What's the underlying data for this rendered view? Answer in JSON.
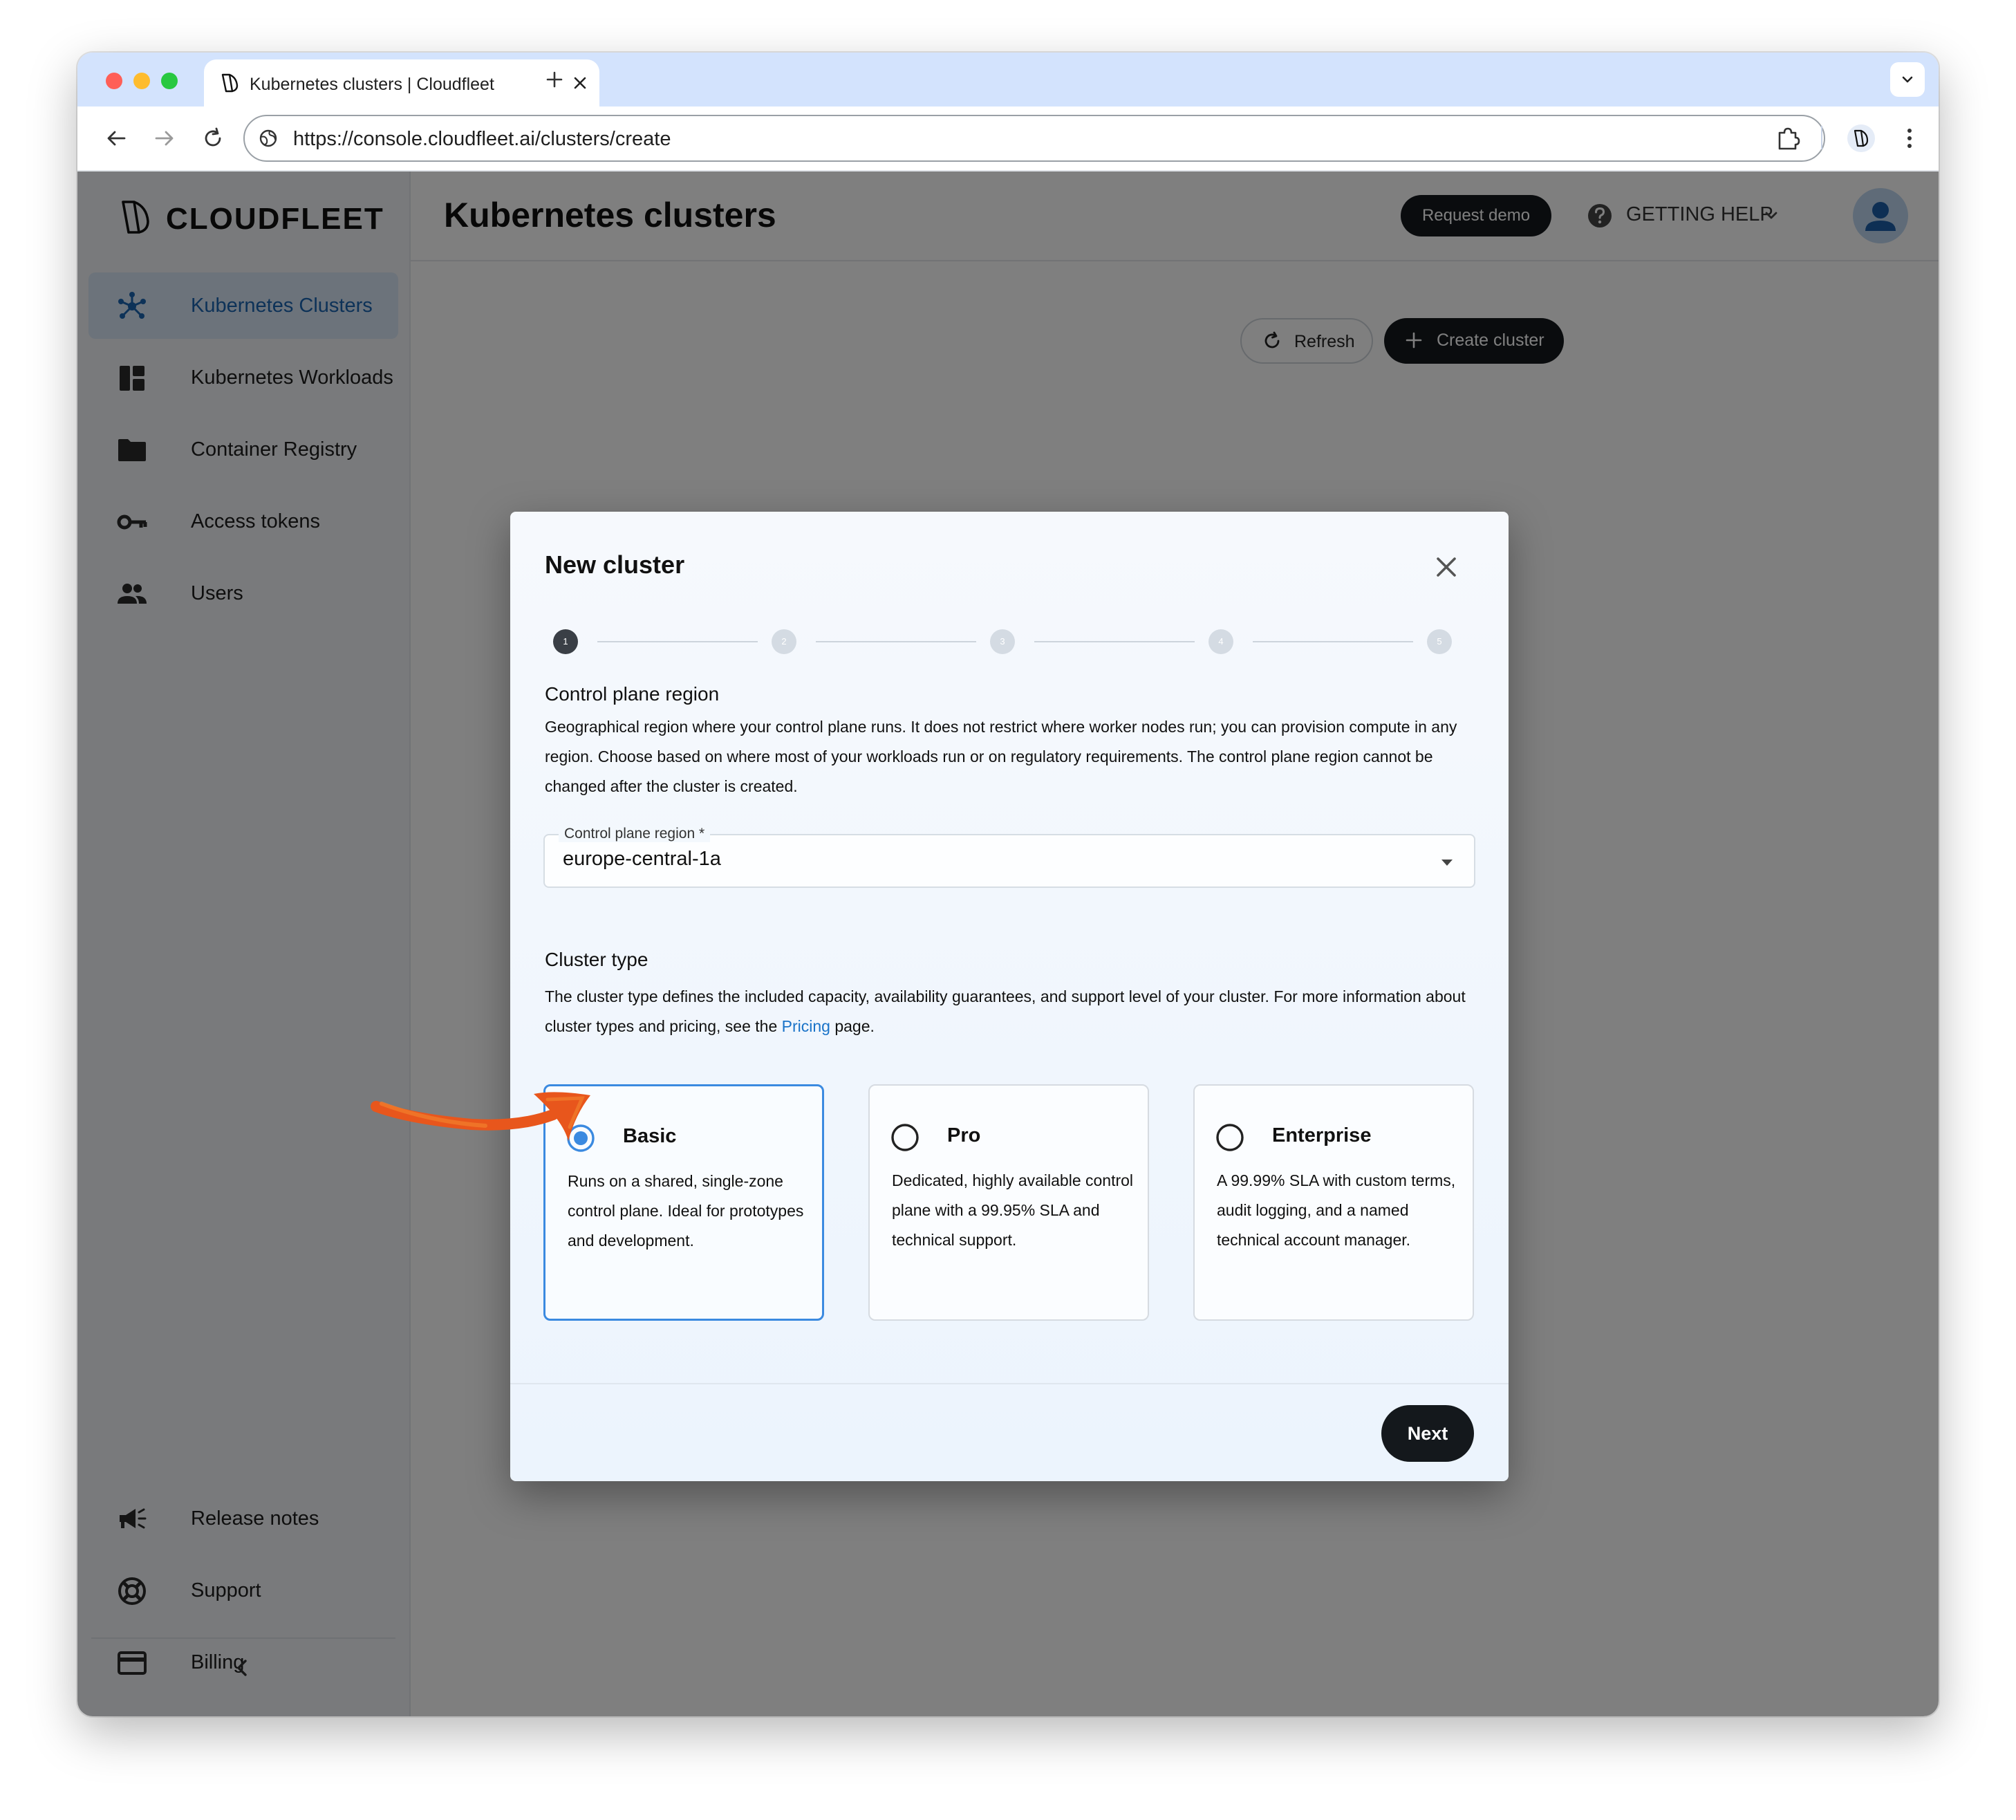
{
  "browser": {
    "tab_title": "Kubernetes clusters | Cloudfleet",
    "url": "https://console.cloudfleet.ai/clusters/create"
  },
  "sidebar": {
    "logo_text": "CLOUDFLEET",
    "items": [
      {
        "label": "Kubernetes Clusters",
        "icon": "kubernetes-icon",
        "active": true
      },
      {
        "label": "Kubernetes Workloads",
        "icon": "dashboard-icon"
      },
      {
        "label": "Container Registry",
        "icon": "folder-icon"
      },
      {
        "label": "Access tokens",
        "icon": "key-icon"
      },
      {
        "label": "Users",
        "icon": "users-icon"
      }
    ],
    "bottom_items": [
      {
        "label": "Release notes",
        "icon": "megaphone-icon"
      },
      {
        "label": "Support",
        "icon": "lifebuoy-icon"
      },
      {
        "label": "Billing",
        "icon": "credit-card-icon"
      }
    ]
  },
  "header": {
    "title": "Kubernetes clusters",
    "request_demo": "Request demo",
    "getting_help": "GETTING HELP"
  },
  "toolbar": {
    "refresh": "Refresh",
    "create_cluster": "Create cluster"
  },
  "modal": {
    "title": "New cluster",
    "steps": [
      "1",
      "2",
      "3",
      "4",
      "5"
    ],
    "active_step": 1,
    "region": {
      "title": "Control plane region",
      "description": "Geographical region where your control plane runs. It does not restrict where worker nodes run; you can provision compute in any region. Choose based on where most of your workloads run or on regulatory requirements. The control plane region cannot be changed after the cluster is created.",
      "field_label": "Control plane region *",
      "value": "europe-central-1a"
    },
    "cluster_type": {
      "title": "Cluster type",
      "description_before": "The cluster type defines the included capacity, availability guarantees, and support level of your cluster. For more information about cluster types and pricing, see the",
      "link": "Pricing",
      "description_after": "page.",
      "options": [
        {
          "title": "Basic",
          "description": "Runs on a shared, single-zone control plane. Ideal for prototypes and development.",
          "selected": true
        },
        {
          "title": "Pro",
          "description": "Dedicated, highly available control plane with a 99.95% SLA and technical support.",
          "selected": false
        },
        {
          "title": "Enterprise",
          "description": "A 99.99% SLA with custom terms, audit logging, and a named technical account manager.",
          "selected": false
        }
      ]
    },
    "next": "Next"
  },
  "colors": {
    "accent": "#3b8ae0",
    "link": "#1a73c8",
    "annotation": "#e8561c",
    "dark_button": "#14181c"
  }
}
